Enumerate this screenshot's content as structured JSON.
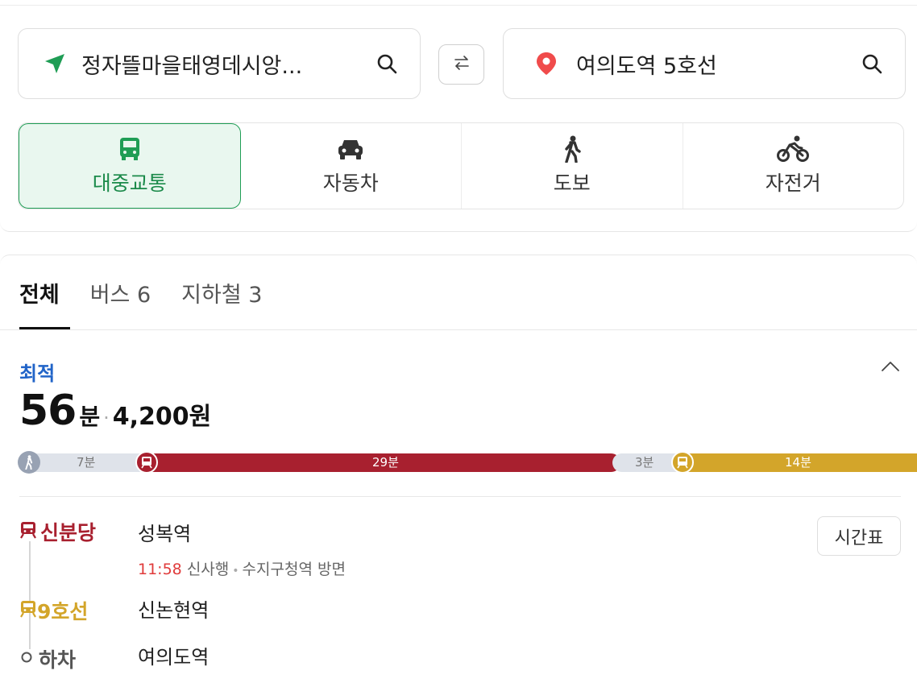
{
  "search": {
    "origin": "정자뜰마을태영데시앙...",
    "destination": "여의도역 5호선"
  },
  "modes": [
    {
      "label": "대중교통",
      "icon": "bus-icon",
      "active": true
    },
    {
      "label": "자동차",
      "icon": "car-icon",
      "active": false
    },
    {
      "label": "도보",
      "icon": "walk-icon",
      "active": false
    },
    {
      "label": "자전거",
      "icon": "bicycle-icon",
      "active": false
    }
  ],
  "tabs": [
    {
      "label": "전체"
    },
    {
      "label": "버스 6"
    },
    {
      "label": "지하철 3"
    }
  ],
  "route": {
    "badge": "최적",
    "total_minutes": "56",
    "minutes_unit": "분",
    "separator": "·",
    "fare": "4,200원",
    "segments": [
      {
        "type": "walk",
        "label": "7분",
        "minutes": 7
      },
      {
        "type": "subway",
        "line": "신분당",
        "label": "29분",
        "minutes": 29,
        "color": "#a8202f"
      },
      {
        "type": "walk",
        "label": "3분",
        "minutes": 3
      },
      {
        "type": "subway",
        "line": "9호선",
        "label": "14분",
        "minutes": 14,
        "color": "#d3a52a"
      }
    ],
    "timetable_label": "시간표",
    "steps": [
      {
        "line": "신분당",
        "station": "성복역",
        "detail_time": "11:58",
        "detail_text": "신사행",
        "detail_dot": "•",
        "detail_direction": "수지구청역 방면",
        "color": "#a8202f"
      },
      {
        "line": "9호선",
        "station": "신논현역",
        "color": "#d3a52a"
      },
      {
        "line": "하차",
        "station": "여의도역",
        "color": "#555555"
      }
    ]
  },
  "colors": {
    "accent_green": "#1f9d55",
    "optimal_blue": "#2164c8",
    "shinbundang": "#a8202f",
    "line9": "#d3a52a",
    "walk_bar": "#dfe3ea"
  }
}
